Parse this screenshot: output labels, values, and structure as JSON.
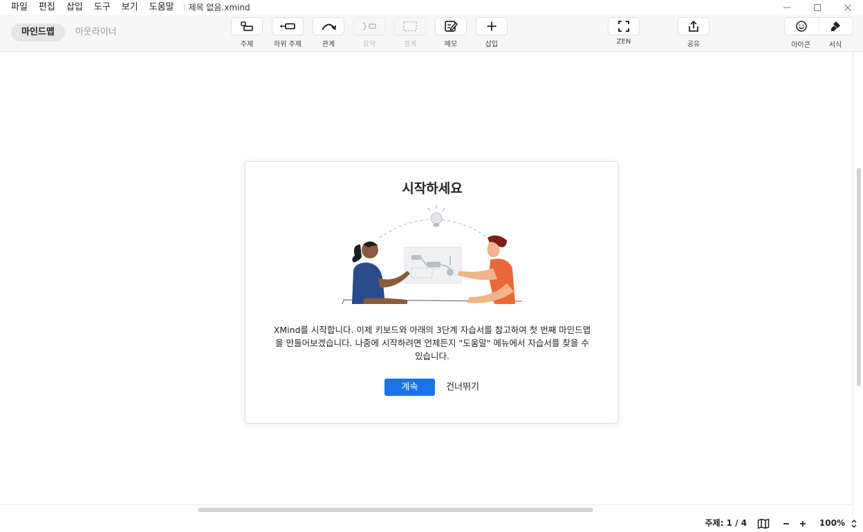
{
  "menu": {
    "items": [
      "파일",
      "편집",
      "삽입",
      "도구",
      "보기",
      "도움말"
    ],
    "doc_title": "제목 없음.xmind"
  },
  "toolbar": {
    "modes": {
      "mindmap": "마인드맵",
      "outliner": "아웃라이너"
    },
    "tools": {
      "topic": "주제",
      "subtopic": "하위 주제",
      "relationship": "관계",
      "summary": "요약",
      "boundary": "경계",
      "note": "메모",
      "insert": "삽입",
      "zen": "ZEN",
      "share": "공유",
      "icon": "아이콘",
      "format": "서식"
    },
    "icons": {
      "topic": "topic-icon",
      "subtopic": "subtopic-icon",
      "relationship": "relationship-arc-icon",
      "summary": "summary-bracket-icon",
      "boundary": "boundary-dashed-icon",
      "note": "note-edit-icon",
      "insert": "plus-icon",
      "zen": "fullscreen-corners-icon",
      "share": "share-upload-icon",
      "icon": "smiley-icon",
      "format": "paint-brush-icon"
    }
  },
  "dialog": {
    "title": "시작하세요",
    "body": "XMind를 시작합니다. 이제 키보드와 아래의 3단계 자습서를 참고하여 첫 번째 마인드맵을 만들어보겠습니다. 나중에 시작하려면 언제든지 \"도움말\" 메뉴에서 자습서를 찾을 수 있습니다.",
    "continue_label": "계속",
    "skip_label": "건너뛰기"
  },
  "status": {
    "topic_count": "주제: 1 / 4",
    "zoom": "100%"
  },
  "colors": {
    "accent": "#1a73e8",
    "toolbar_bg": "#f7f7f7",
    "disabled_text": "#bbbbbb"
  }
}
